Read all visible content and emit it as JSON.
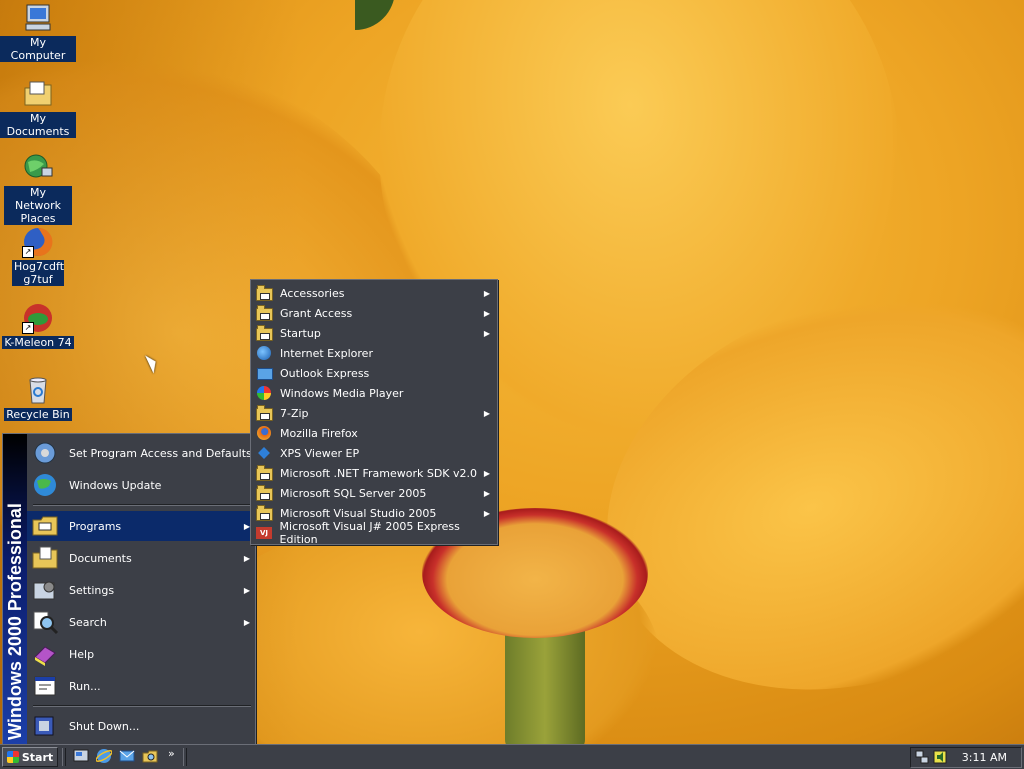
{
  "desktop": {
    "icons": [
      {
        "label": "My Computer",
        "icon": "computer-icon"
      },
      {
        "label": "My Documents",
        "icon": "documents-folder-icon"
      },
      {
        "label": "My Network Places",
        "icon": "network-icon"
      },
      {
        "label": "Hog7cdft g7tuf",
        "icon": "firefox-icon"
      },
      {
        "label": "K-Meleon 74",
        "icon": "kmeleon-icon"
      },
      {
        "label": "Recycle Bin",
        "icon": "recycle-bin-icon"
      }
    ]
  },
  "start_menu": {
    "banner": "Windows 2000 Professional",
    "top_items": [
      {
        "label": "Set Program Access and Defaults",
        "icon": "program-access-icon"
      },
      {
        "label": "Windows Update",
        "icon": "windows-update-icon"
      }
    ],
    "items": [
      {
        "label": "Programs",
        "icon": "programs-folder-icon",
        "submenu": true,
        "active": true
      },
      {
        "label": "Documents",
        "icon": "documents-icon",
        "submenu": true
      },
      {
        "label": "Settings",
        "icon": "settings-icon",
        "submenu": true
      },
      {
        "label": "Search",
        "icon": "search-icon",
        "submenu": true
      },
      {
        "label": "Help",
        "icon": "help-icon",
        "submenu": false
      },
      {
        "label": "Run...",
        "icon": "run-icon",
        "submenu": false
      }
    ],
    "shutdown": {
      "label": "Shut Down...",
      "icon": "shutdown-icon"
    }
  },
  "programs_menu": {
    "items": [
      {
        "label": "Accessories",
        "icon": "folder-icon",
        "submenu": true
      },
      {
        "label": "Grant Access",
        "icon": "folder-icon",
        "submenu": true
      },
      {
        "label": "Startup",
        "icon": "folder-icon",
        "submenu": true
      },
      {
        "label": "Internet Explorer",
        "icon": "internet-explorer-icon",
        "submenu": false
      },
      {
        "label": "Outlook Express",
        "icon": "outlook-express-icon",
        "submenu": false
      },
      {
        "label": "Windows Media Player",
        "icon": "media-player-icon",
        "submenu": false
      },
      {
        "label": "7-Zip",
        "icon": "folder-icon",
        "submenu": true
      },
      {
        "label": "Mozilla Firefox",
        "icon": "firefox-icon",
        "submenu": false
      },
      {
        "label": "XPS Viewer EP",
        "icon": "xps-viewer-icon",
        "submenu": false
      },
      {
        "label": "Microsoft .NET Framework SDK v2.0",
        "icon": "folder-icon",
        "submenu": true
      },
      {
        "label": "Microsoft SQL Server 2005",
        "icon": "folder-icon",
        "submenu": true
      },
      {
        "label": "Microsoft Visual Studio 2005",
        "icon": "folder-icon",
        "submenu": true
      },
      {
        "label": "Microsoft Visual J# 2005 Express Edition",
        "icon": "visual-jsharp-icon",
        "submenu": false
      }
    ]
  },
  "taskbar": {
    "start_label": "Start",
    "quick_launch": [
      "show-desktop-icon",
      "internet-explorer-icon",
      "outlook-express-icon",
      "explorer-icon"
    ],
    "more": "»",
    "tray_icons": [
      "network-tray-icon",
      "volume-tray-icon"
    ],
    "clock": "3:11 AM"
  },
  "colors": {
    "menu_bg": "#3c3f47",
    "highlight": "#0b2a6a",
    "icon_label_bg": "#0b2a5c"
  }
}
